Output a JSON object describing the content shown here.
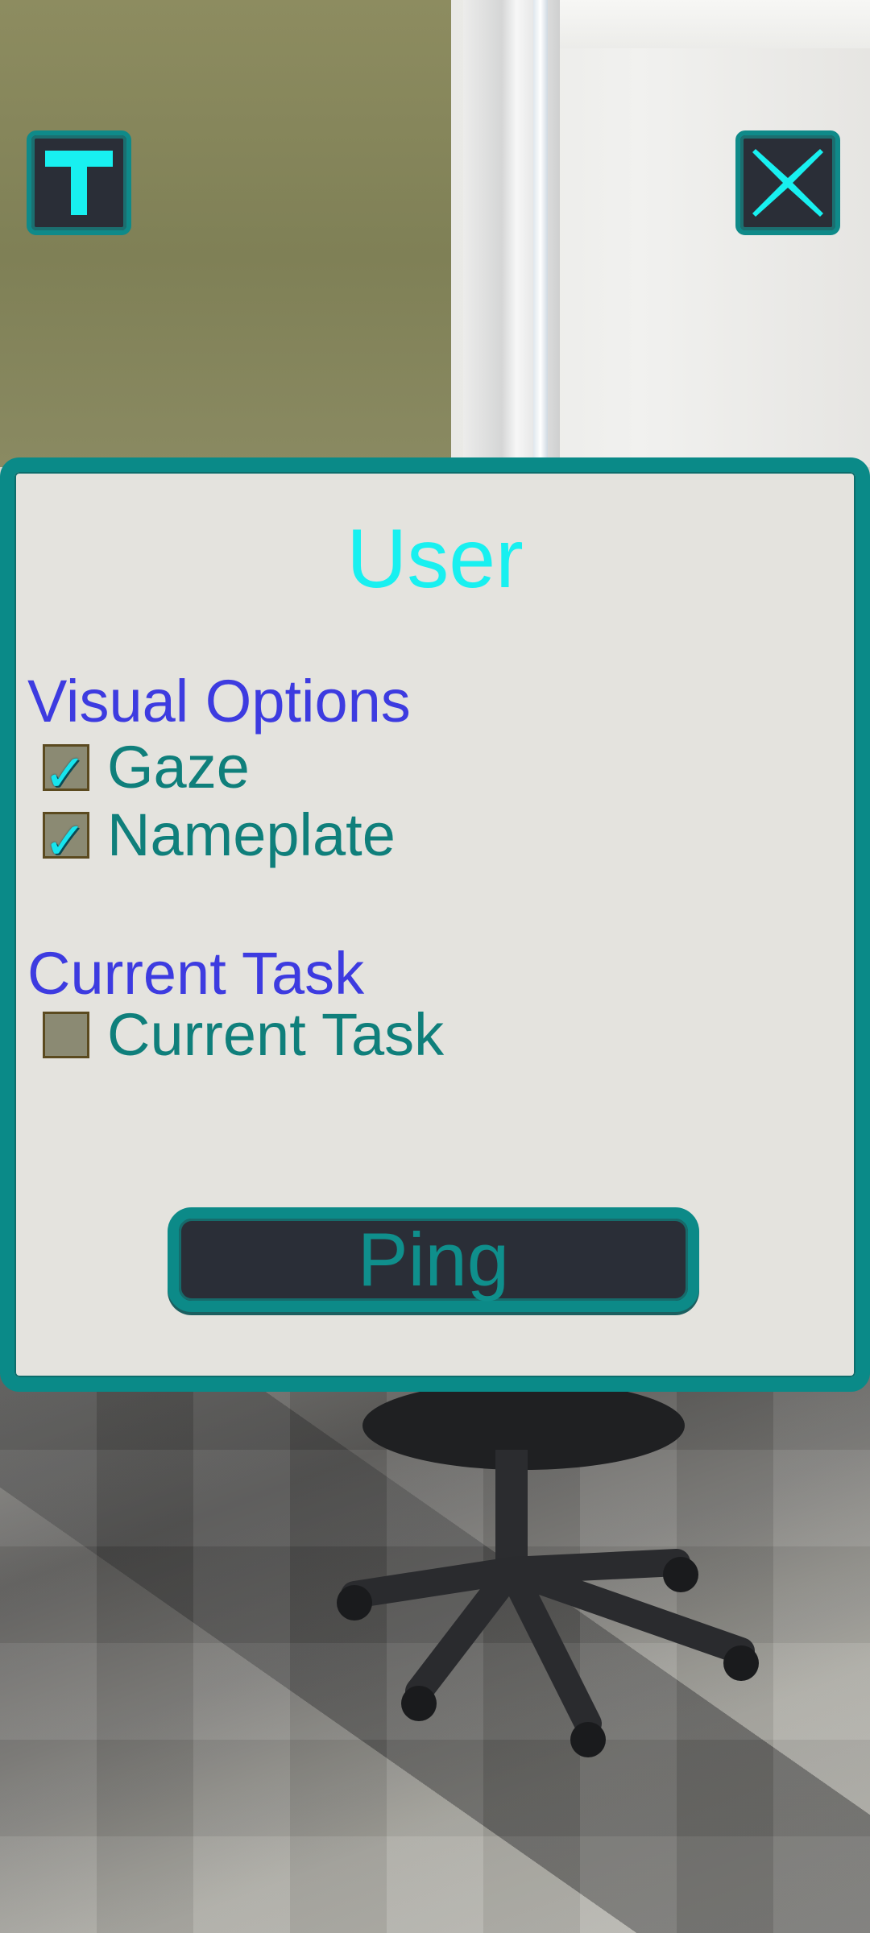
{
  "panel": {
    "title": "User",
    "sections": [
      {
        "title": "Visual Options",
        "options": [
          {
            "label": "Gaze",
            "checked": true
          },
          {
            "label": "Nameplate",
            "checked": true
          }
        ]
      },
      {
        "title": "Current Task",
        "options": [
          {
            "label": "Current Task",
            "checked": false
          }
        ]
      }
    ],
    "action_label": "Ping"
  },
  "toolbar": {
    "left_icon": "t-icon",
    "right_icon": "close-icon"
  },
  "colors": {
    "accent_teal": "#0a8a88",
    "title_cyan": "#18f0f0",
    "section_blue": "#3d3be0",
    "option_teal": "#0f7f7b",
    "button_dark": "#2a2e37",
    "panel_bg": "#e4e3de"
  }
}
